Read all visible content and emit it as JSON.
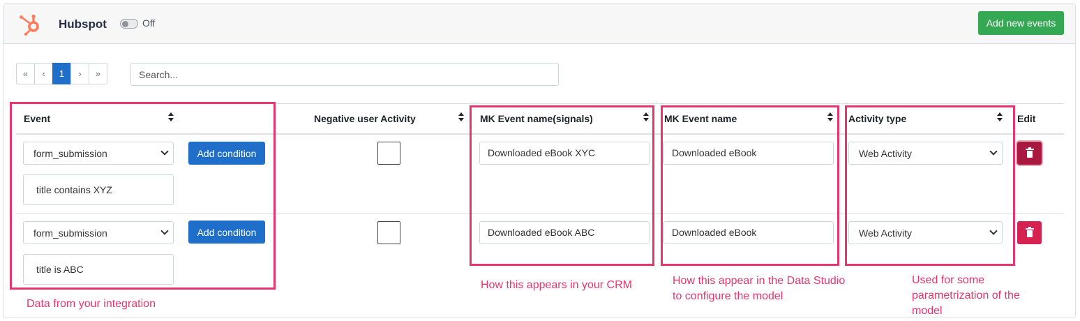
{
  "header": {
    "app_name": "Hubspot",
    "toggle_label": "Off",
    "toggle_on": false,
    "add_events_label": "Add new events",
    "brand_color": "#ff7a59"
  },
  "pagination": {
    "first": "«",
    "prev": "‹",
    "current": "1",
    "next": "›",
    "last": "»"
  },
  "search": {
    "placeholder": "Search..."
  },
  "table": {
    "columns": {
      "event": "Event",
      "negative": "Negative user Activity",
      "mk_signals": "MK Event name(signals)",
      "mk_name": "MK Event name",
      "activity_type": "Activity type",
      "edit": "Edit"
    },
    "rows": [
      {
        "event": "form_submission",
        "add_condition": "Add condition",
        "condition": "title contains XYZ",
        "negative_checked": false,
        "mk_signals": "Downloaded eBook XYC",
        "mk_name": "Downloaded eBook",
        "activity_type": "Web Activity"
      },
      {
        "event": "form_submission",
        "add_condition": "Add condition",
        "condition": "title is ABC",
        "negative_checked": false,
        "mk_signals": "Downloaded eBook ABC",
        "mk_name": "Downloaded eBook",
        "activity_type": "Web Activity"
      }
    ]
  },
  "annotations": {
    "integration": "Data from your integration",
    "crm": "How this appears in your CRM",
    "studio": "How this appear in the Data Studio\n to configure the model",
    "param": "Used for some\nparametrization of the\nmodel",
    "color": "#e8356d"
  }
}
